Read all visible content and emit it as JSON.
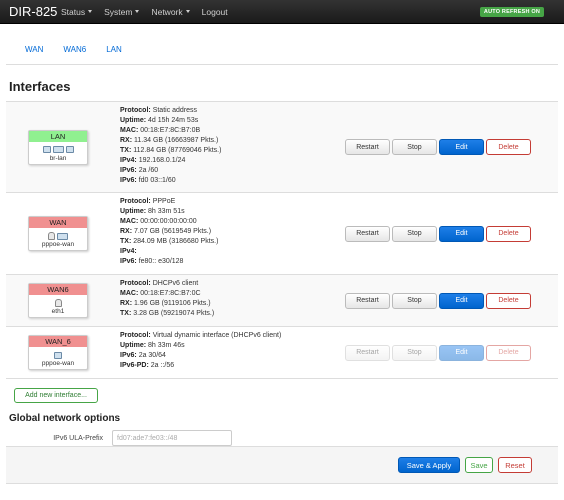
{
  "navbar": {
    "brand": "DIR-825",
    "menu": [
      {
        "label": "Status",
        "dropdown": true
      },
      {
        "label": "System",
        "dropdown": true
      },
      {
        "label": "Network",
        "dropdown": true
      },
      {
        "label": "Logout",
        "dropdown": false
      }
    ],
    "auto_refresh": "AUTO REFRESH ON"
  },
  "tabs": [
    "WAN",
    "WAN6",
    "LAN"
  ],
  "page_title": "Interfaces",
  "interfaces": [
    {
      "name": "LAN",
      "color": "green",
      "device": "br-lan",
      "info": [
        {
          "k": "Protocol:",
          "v": "Static address"
        },
        {
          "k": "Uptime:",
          "v": "4d 15h 24m 53s"
        },
        {
          "k": "MAC:",
          "v": "00:18:E7:8C:B7:0B"
        },
        {
          "k": "RX:",
          "v": "11.34 GB (16663987 Pkts.)"
        },
        {
          "k": "TX:",
          "v": "112.84 GB (87769046 Pkts.)"
        },
        {
          "k": "IPv4:",
          "v": "192.168.0.1/24"
        },
        {
          "k": "IPv6:",
          "v": "2a                         /60"
        },
        {
          "k": "IPv6:",
          "v": "fd0            03::1/60"
        }
      ],
      "disabled": false
    },
    {
      "name": "WAN",
      "color": "red",
      "device": "pppoe-wan",
      "info": [
        {
          "k": "Protocol:",
          "v": "PPPoE"
        },
        {
          "k": "Uptime:",
          "v": "8h 33m 51s"
        },
        {
          "k": "MAC:",
          "v": "00:00:00:00:00:00"
        },
        {
          "k": "RX:",
          "v": "7.07 GB (5619549 Pkts.)"
        },
        {
          "k": "TX:",
          "v": "284.09 MB (3186680 Pkts.)"
        },
        {
          "k": "IPv4:",
          "v": ""
        },
        {
          "k": "IPv6:",
          "v": "fe80::                       e30/128"
        }
      ],
      "disabled": false
    },
    {
      "name": "WAN6",
      "color": "red",
      "device": "eth1",
      "info": [
        {
          "k": "Protocol:",
          "v": "DHCPv6 client"
        },
        {
          "k": "MAC:",
          "v": "00:18:E7:8C:B7:0C"
        },
        {
          "k": "RX:",
          "v": "1.96 GB (9119106 Pkts.)"
        },
        {
          "k": "TX:",
          "v": "3.28 GB (59219074 Pkts.)"
        }
      ],
      "disabled": false
    },
    {
      "name": "WAN_6",
      "color": "red",
      "device": "pppoe-wan",
      "info": [
        {
          "k": "Protocol:",
          "v": "Virtual dynamic interface (DHCPv6 client)"
        },
        {
          "k": "Uptime:",
          "v": "8h 33m 46s"
        },
        {
          "k": "IPv6:",
          "v": "2a                              30/64"
        },
        {
          "k": "IPv6-PD:",
          "v": "2a                    ::/56"
        }
      ],
      "disabled": true
    }
  ],
  "buttons": {
    "restart": "Restart",
    "stop": "Stop",
    "edit": "Edit",
    "delete": "Delete"
  },
  "add_interface": "Add new interface...",
  "global_options": {
    "title": "Global network options",
    "ula_label": "IPv6 ULA-Prefix",
    "ula_value": "fd07:ade7:fe03::/48"
  },
  "footer": {
    "apply": "Save & Apply",
    "save": "Save",
    "reset": "Reset"
  }
}
